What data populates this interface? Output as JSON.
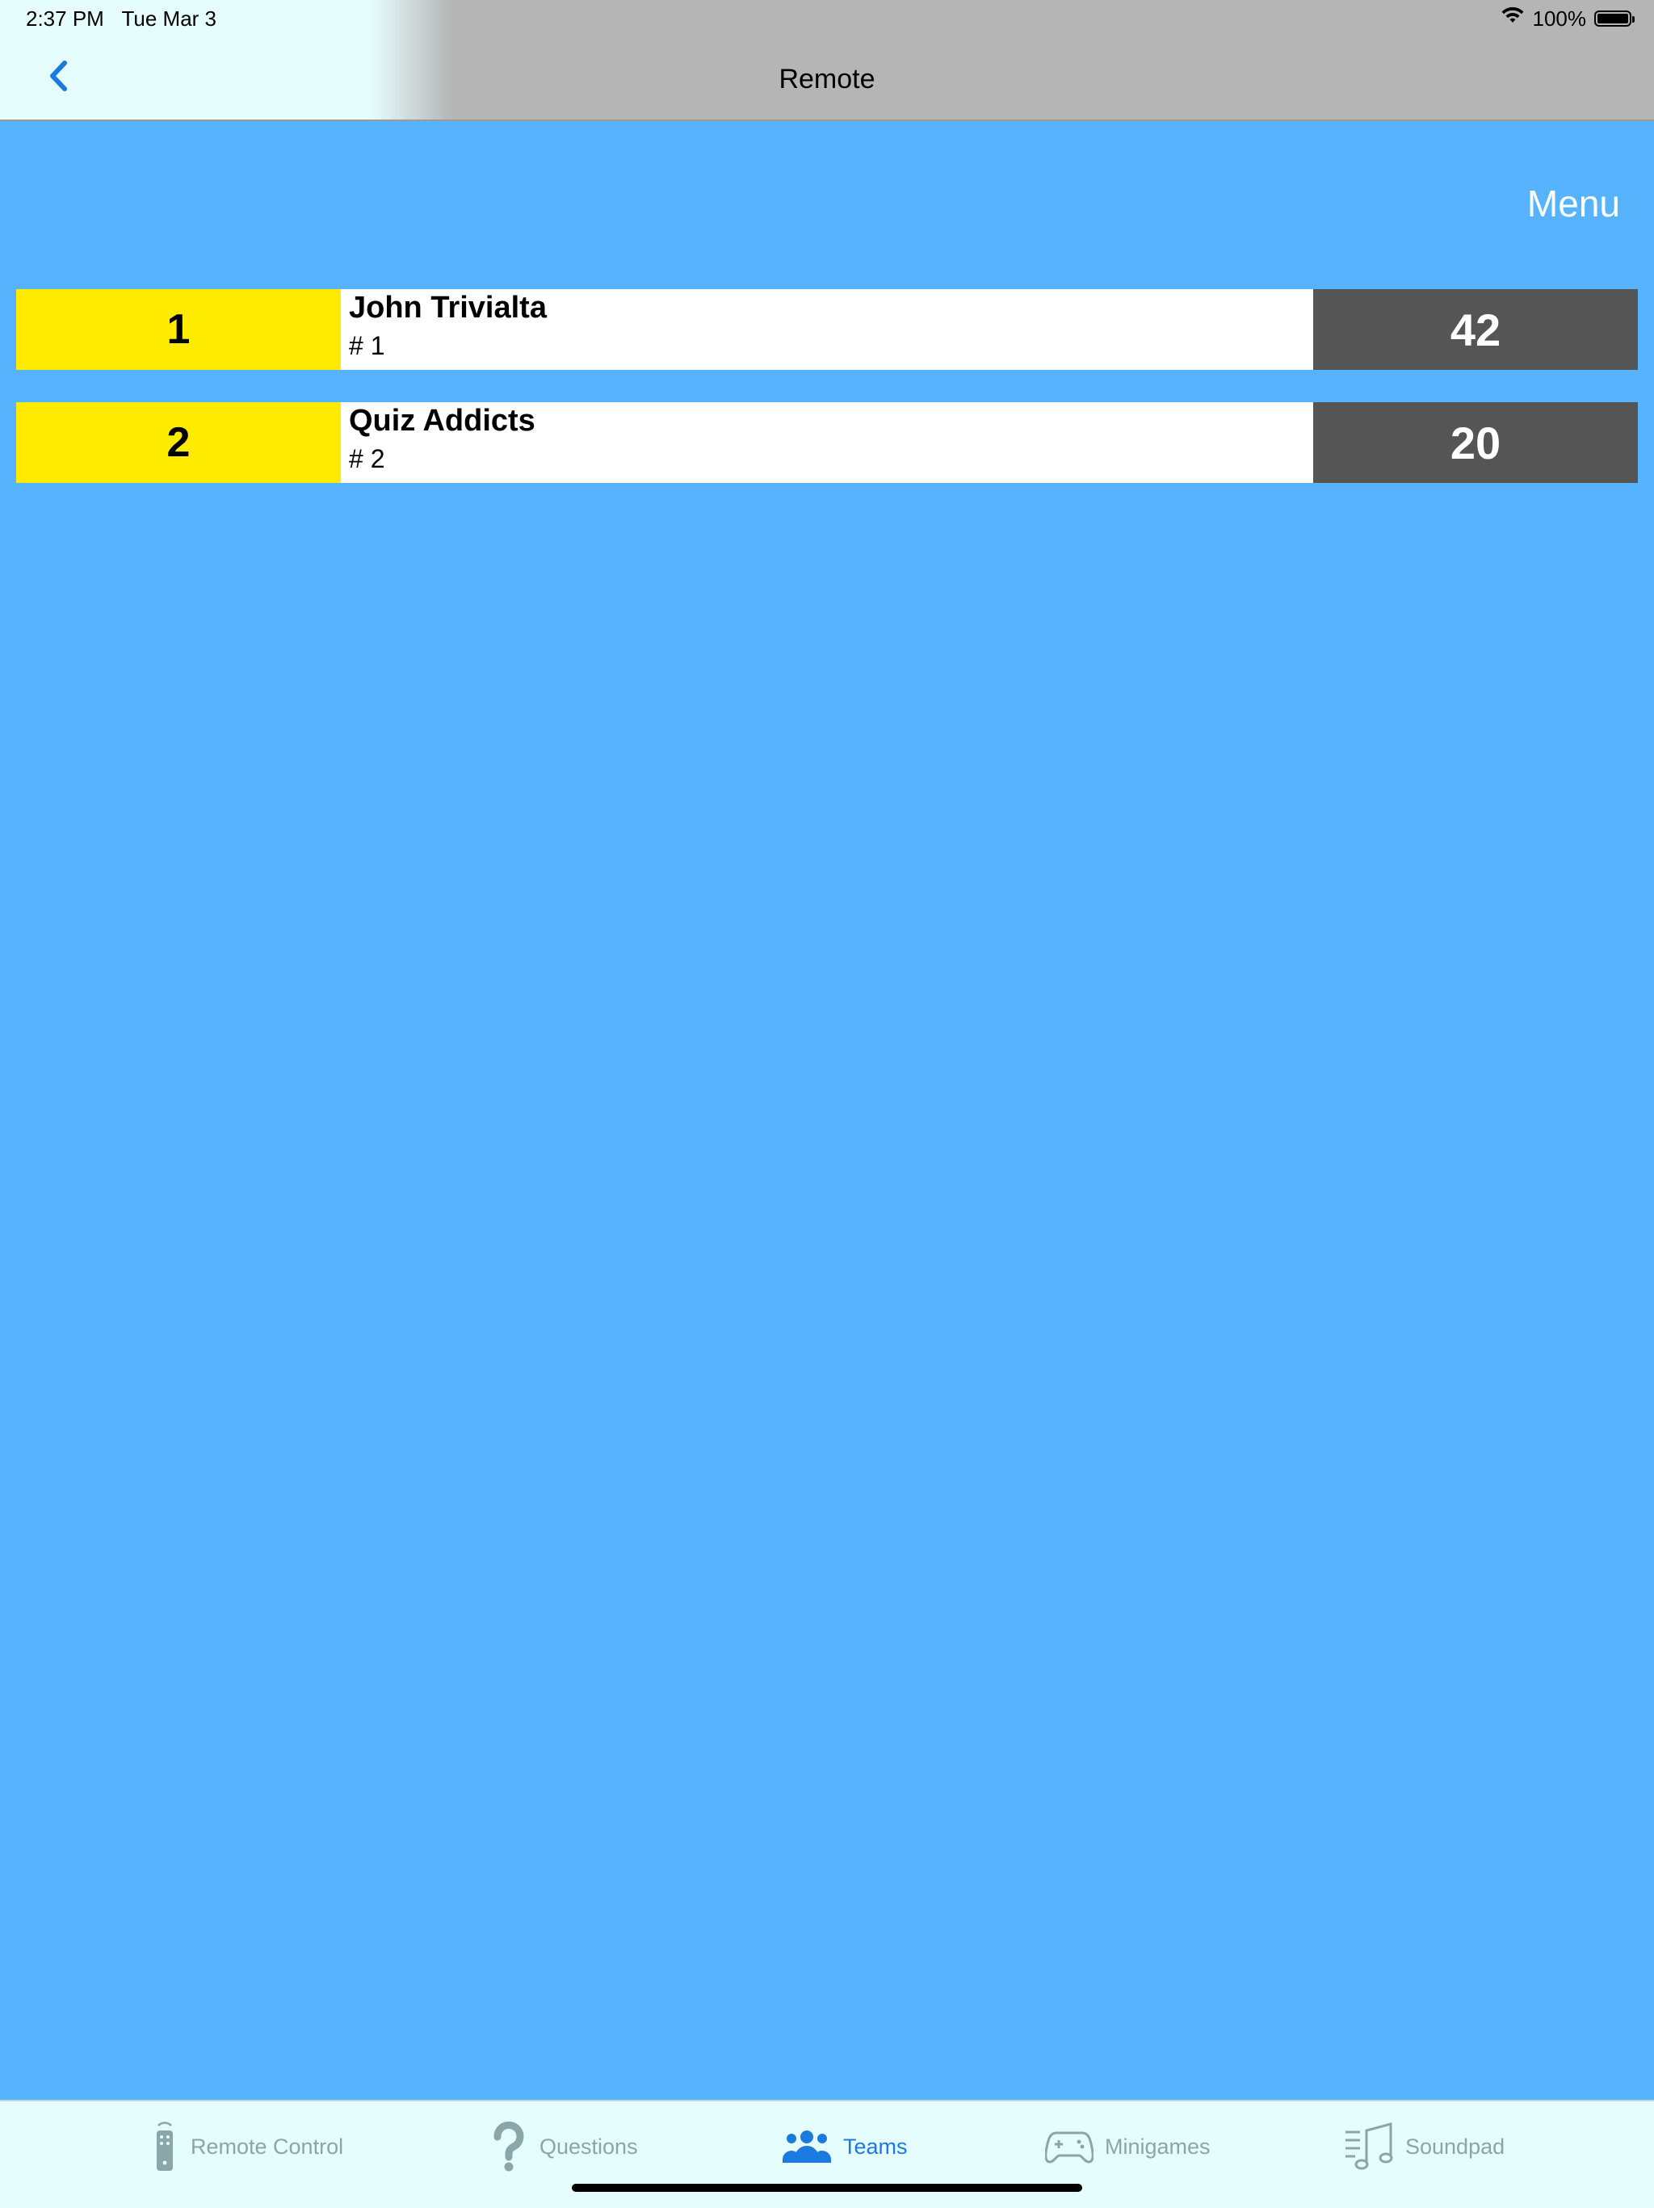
{
  "status_bar": {
    "time": "2:37 PM",
    "date": "Tue Mar 3",
    "battery_text": "100%",
    "battery_level": 1.0
  },
  "nav": {
    "title": "Remote",
    "back_icon": "chevron-left-icon"
  },
  "content": {
    "menu_label": "Menu",
    "teams": [
      {
        "rank": "1",
        "name": "John Trivialta",
        "number": "# 1",
        "score": "42"
      },
      {
        "rank": "2",
        "name": "Quiz Addicts",
        "number": "# 2",
        "score": "20"
      }
    ]
  },
  "tab_bar": {
    "tabs": [
      {
        "label": "Remote Control",
        "icon": "remote-icon",
        "active": false
      },
      {
        "label": "Questions",
        "icon": "question-mark-icon",
        "active": false
      },
      {
        "label": "Teams",
        "icon": "people-icon",
        "active": true
      },
      {
        "label": "Minigames",
        "icon": "gamepad-icon",
        "active": false
      },
      {
        "label": "Soundpad",
        "icon": "music-note-icon",
        "active": false
      }
    ]
  },
  "colors": {
    "background": "#57b3fd",
    "rank_cell": "#ffeb00",
    "score_cell": "#555555",
    "tab_active": "#1a7ae0",
    "tab_inactive": "#8aa6a8"
  }
}
